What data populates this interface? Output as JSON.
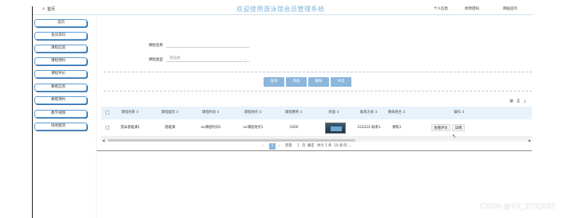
{
  "header": {
    "home_label": "首页",
    "title": "欢迎使用游泳馆会员管理系统",
    "links": [
      "个人信息",
      "修改密码",
      "网站首页"
    ]
  },
  "sidebar": {
    "items": [
      {
        "label": "首页"
      },
      {
        "label": "会员资料"
      },
      {
        "label": "课程信息"
      },
      {
        "label": "课程预约"
      },
      {
        "label": "课程评价"
      },
      {
        "label": "教练信息"
      },
      {
        "label": "教练预约"
      },
      {
        "label": "教学视频"
      },
      {
        "label": "场地租赁"
      }
    ]
  },
  "search": {
    "course_name_label": "课程名称",
    "course_name_placeholder": "",
    "course_type_label": "课程类型",
    "course_type_value": "请选择"
  },
  "actions": {
    "search": "查询",
    "add": "添加",
    "delete": "删除",
    "export": "导出"
  },
  "table": {
    "columns": [
      "课程名称",
      "课程类别",
      "课程时间",
      "课程地点",
      "课程费用",
      "封面",
      "联系方式",
      "教练姓名",
      "操作"
    ],
    "rows": [
      {
        "name": "游泳基础课1",
        "type": "基础课",
        "time": "xx课程时间1",
        "place": "xx课程地点1",
        "fee": "1000",
        "phone": "222222-联系1",
        "coach": "教练1",
        "ops": [
          "查看评论",
          "详情"
        ]
      }
    ]
  },
  "pagination": {
    "page": "1",
    "goto_label": "到第",
    "page_input": "1",
    "page_unit": "页",
    "confirm": "确定",
    "total": "共计 1 条",
    "page_size": "10 条/页"
  },
  "watermark": "CSDN @VX_ZYKJ985",
  "colors": {
    "accent": "#8cb6dc",
    "title": "#7fb3d9",
    "sidebar_border": "#5b9bd5"
  }
}
